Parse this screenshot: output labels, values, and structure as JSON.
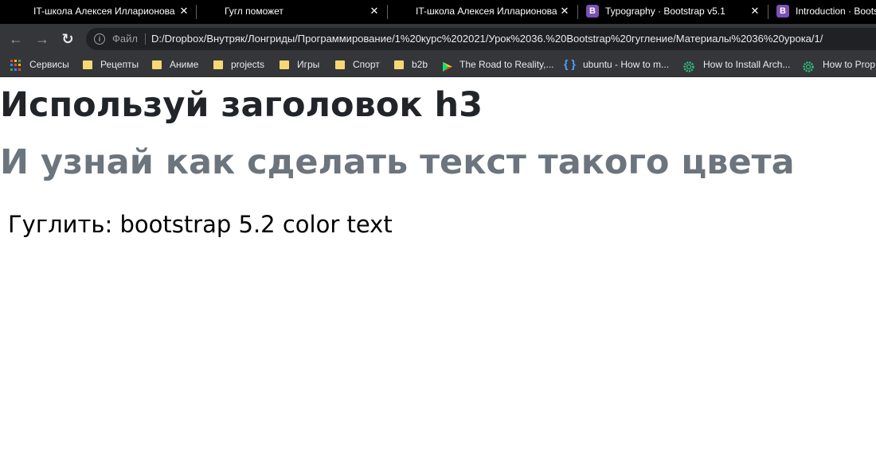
{
  "tabs": [
    {
      "title": "IT-школа Алексея Илларионова",
      "icon": "none",
      "close": "✕"
    },
    {
      "title": "Гугл поможет",
      "icon": "none",
      "close": "✕"
    },
    {
      "title": "IT-школа Алексея Илларионова",
      "icon": "none",
      "close": "✕"
    },
    {
      "title": "Typography · Bootstrap v5.1",
      "icon": "bootstrap-icon",
      "close": "✕"
    },
    {
      "title": "Introduction · Boots",
      "icon": "bootstrap-icon",
      "close": ""
    }
  ],
  "bootstrap_icon_letter": "B",
  "toolbar": {
    "back": "←",
    "forward": "→",
    "reload": "↻",
    "info_glyph": "i",
    "scheme_label": "Файл",
    "url": "D:/Dropbox/Внутряк/Лонгриды/Программирование/1%20курс%202021/Урок%2036.%20Bootstrap%20гугление/Материалы%2036%20урока/1/"
  },
  "bookmarks": [
    {
      "label": "Сервисы",
      "icon": "apps-icon"
    },
    {
      "label": "Рецепты",
      "icon": "folder-icon"
    },
    {
      "label": "Аниме",
      "icon": "folder-icon"
    },
    {
      "label": "projects",
      "icon": "folder-icon"
    },
    {
      "label": "Игры",
      "icon": "folder-icon"
    },
    {
      "label": "Спорт",
      "icon": "folder-icon"
    },
    {
      "label": "b2b",
      "icon": "folder-icon"
    },
    {
      "label": "The Road to Reality,...",
      "icon": "play-store-icon"
    },
    {
      "label": "ubuntu - How to m...",
      "icon": "braces-icon"
    },
    {
      "label": "How to Install Arch...",
      "icon": "gear-icon"
    },
    {
      "label": "How to Prop",
      "icon": "gear-icon"
    }
  ],
  "page": {
    "heading": "Используй заголовок h3",
    "muted_heading": "И узнай как сделать текст такого цвета",
    "hint": "Гуглить: bootstrap 5.2 color text"
  },
  "colors": {
    "tab_bar": "#000000",
    "toolbar": "#35363a",
    "omnibox": "#202124",
    "heading": "#212529",
    "muted": "#6c757d",
    "bootstrap_purple": "#7952b3",
    "folder": "#f7d774"
  }
}
